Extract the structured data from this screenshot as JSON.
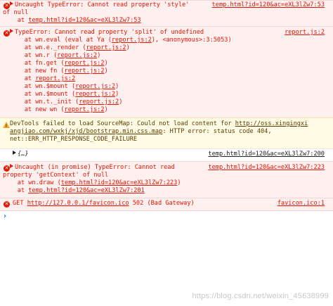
{
  "console": {
    "messages": [
      {
        "level": "error",
        "expandable": true,
        "lines": [
          "Uncaught TypeError: Cannot read property 'style'",
          "of null",
          "    at temp.html?id=120&ac=eXL3lZw7:53"
        ],
        "source": "temp.html?id=120&ac=eXL3lZw7:53"
      },
      {
        "level": "error",
        "expandable": true,
        "lines": [
          "TypeError: Cannot read property 'split' of undefined",
          "    at wn.eval (eval at Ya (report.js:2), <anonymous>:3:5053)",
          "    at wn.e._render (report.js:2)",
          "    at wn.r (report.js:2)",
          "    at fn.get (report.js:2)",
          "    at new fn (report.js:2)",
          "    at report.js:2",
          "    at wn.$mount (report.js:2)",
          "    at wn.$mount (report.js:2)",
          "    at wn.t._init (report.js:2)",
          "    at new wn (report.js:2)"
        ],
        "source": "report.js:2"
      },
      {
        "level": "warning",
        "lines": [
          "DevTools failed to load SourceMap: Could not load content for http://oss.xingingxi",
          "angjiao.com/wxkj/xjd/bootstrap.min.css.map: HTTP error: status code 404,",
          "net::ERR_HTTP_RESPONSE_CODE_FAILURE"
        ]
      },
      {
        "level": "log",
        "expandable": true,
        "lines": [
          "{…}"
        ],
        "source": "temp.html?id=120&ac=eXL3lZw7:200"
      },
      {
        "level": "error",
        "expandable": true,
        "lines": [
          "Uncaught (in promise) TypeError: Cannot read",
          "property 'getContext' of null",
          "    at wn.draw (temp.html?id=120&ac=eXL3lZw7:223)",
          "    at temp.html?id=120&ac=eXL3lZw7:201"
        ],
        "source": "temp.html?id=120&ac=eXL3lZw7:223"
      },
      {
        "level": "error",
        "lines": [
          "GET http://127.0.0.1/favicon.ico 502 (Bad Gateway)"
        ],
        "source": "favicon.ico:1"
      }
    ],
    "prompt_symbol": "›"
  },
  "watermark": "https://blog.csdn.net/weixin_45638999",
  "colors": {
    "error_text": "#e51400",
    "error_bg": "#fff0f0",
    "warn_bg": "#fffbe5",
    "warn_icon": "#f2ab26",
    "prompt": "#1a73e8"
  }
}
